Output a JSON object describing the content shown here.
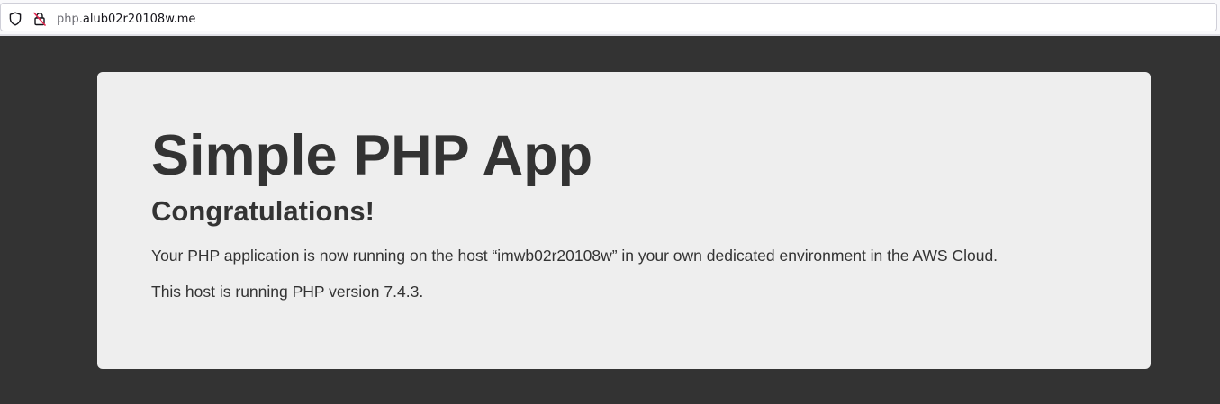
{
  "browser": {
    "url_subdomain": "php.",
    "url_domain": "alub02r20108w.me",
    "icons": {
      "tracking_protection": "shield-icon",
      "connection": "insecure-lock-icon"
    }
  },
  "page": {
    "title": "Simple PHP App",
    "heading": "Congratulations!",
    "paragraph_host": "Your PHP application is now running on the host “imwb02r20108w” in your own dedicated environment in the AWS Cloud.",
    "paragraph_version": "This host is running PHP version 7.4.3."
  },
  "colors": {
    "background": "#333333",
    "panel": "#eeeeee",
    "text": "#333333",
    "insecure_accent": "#e22850"
  }
}
